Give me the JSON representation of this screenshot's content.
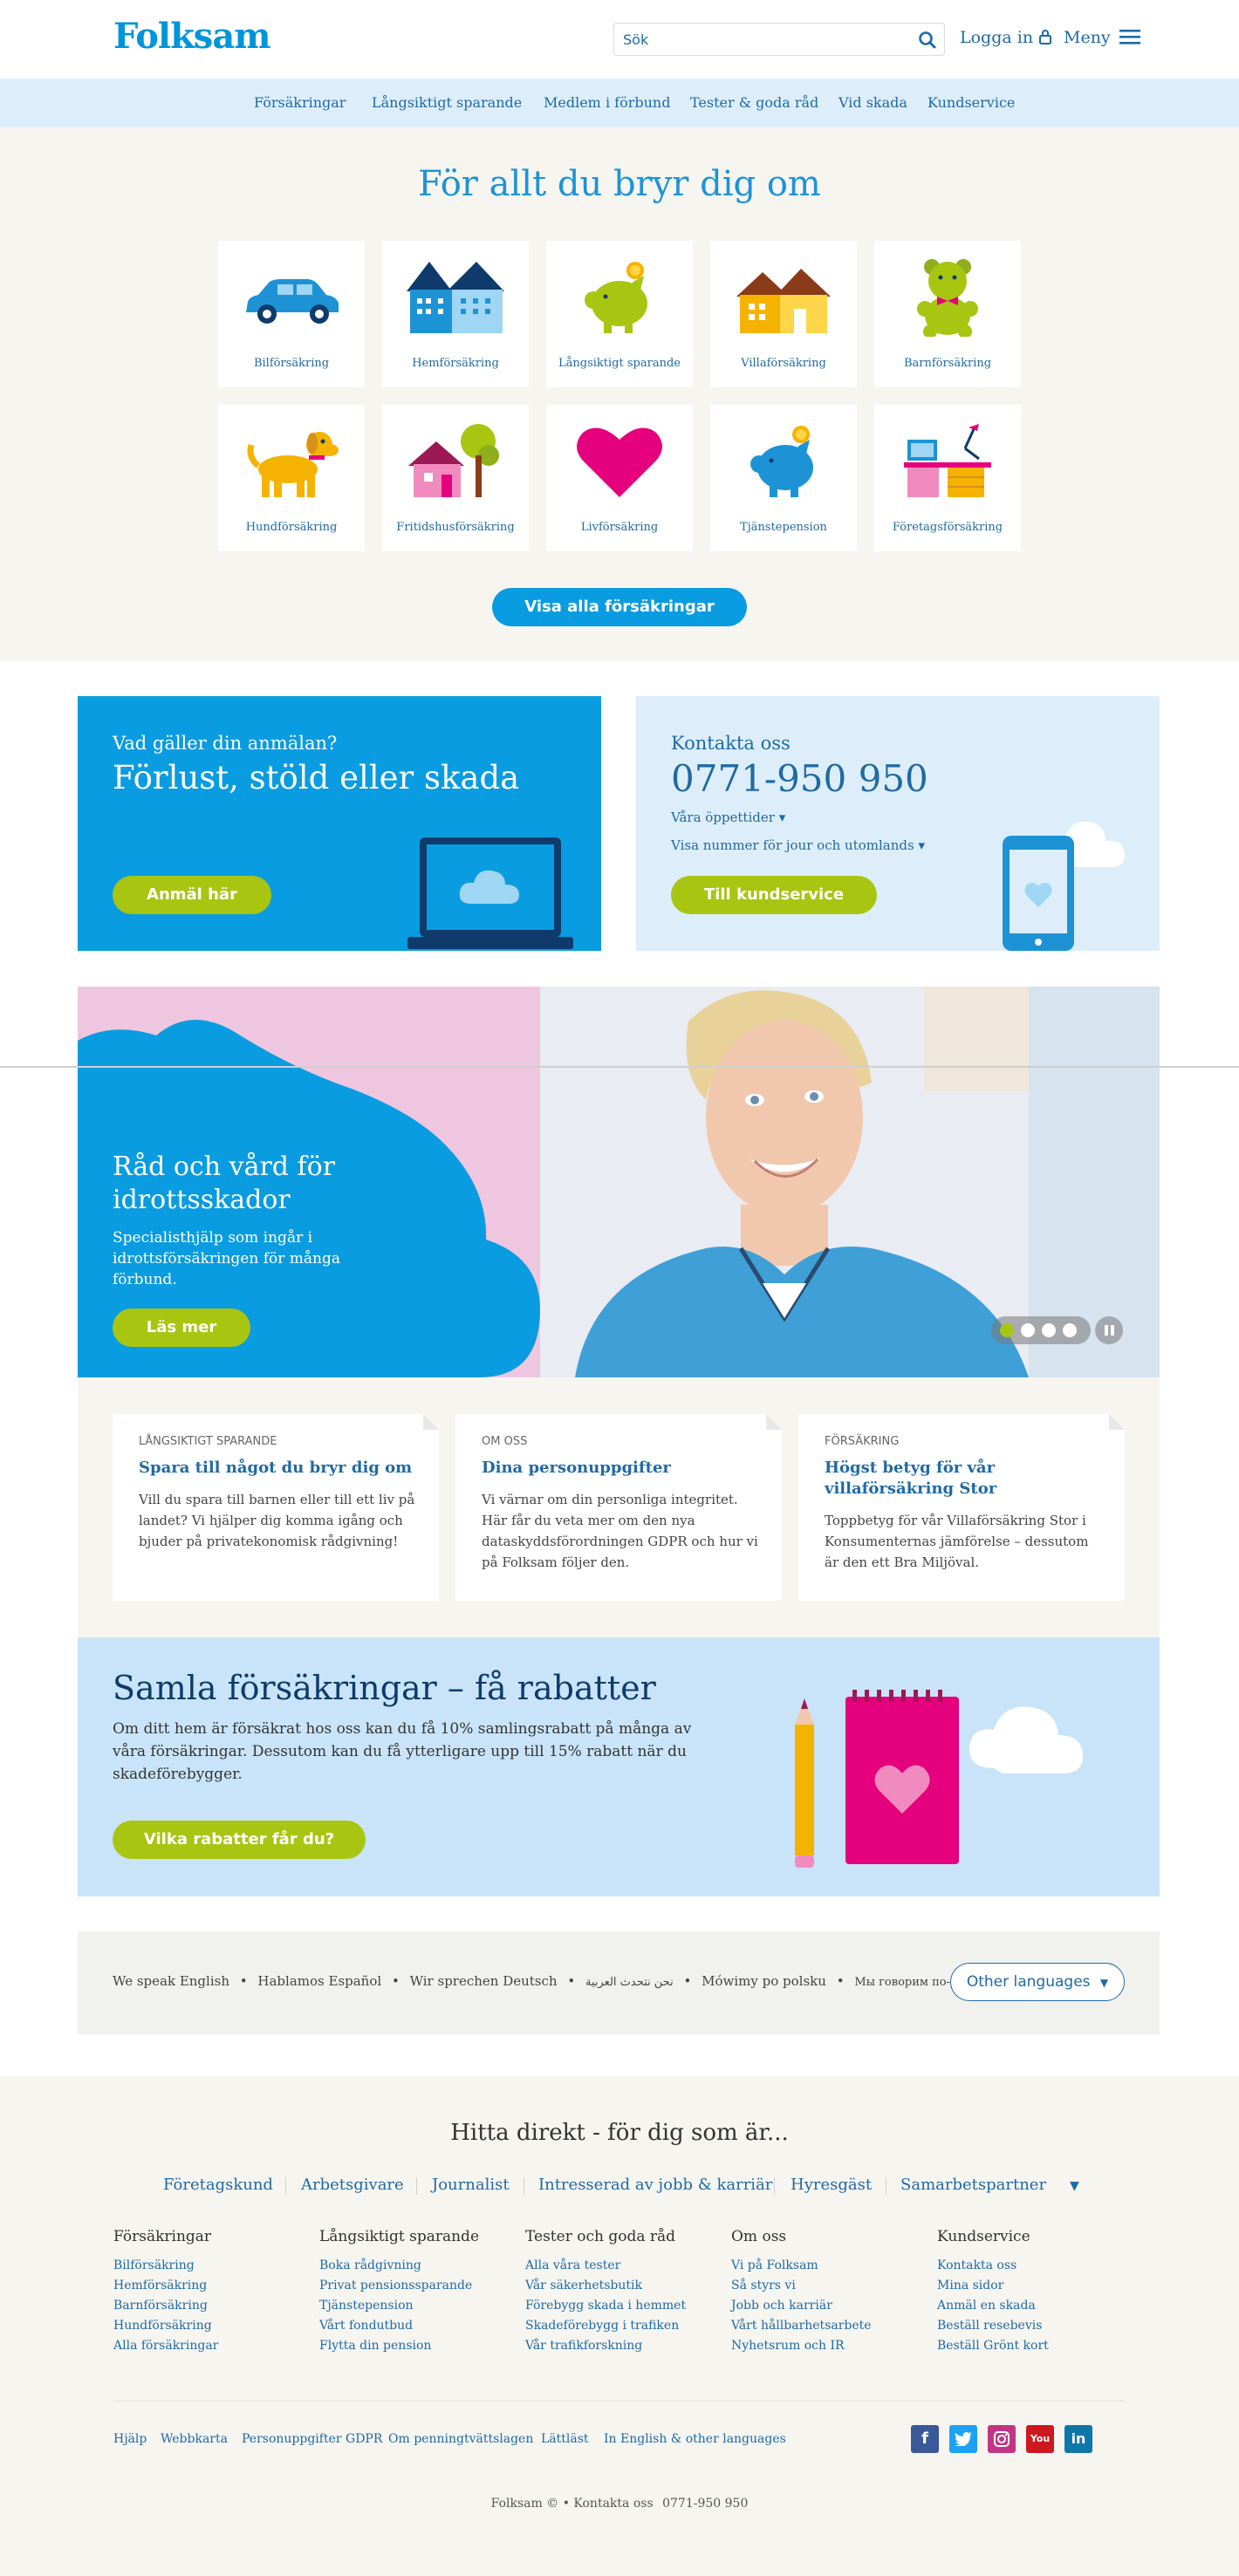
{
  "header": {
    "logo": "Folksam",
    "search_placeholder": "Sök",
    "login": "Logga in",
    "menu": "Meny"
  },
  "nav": [
    "Försäkringar",
    "Långsiktigt sparande",
    "Medlem i förbund",
    "Tester & goda råd",
    "Vid skada",
    "Kundservice"
  ],
  "insurance": {
    "title": "För allt du bryr dig om",
    "cards": [
      {
        "label": "Bilförsäkring",
        "icon": "car-icon"
      },
      {
        "label": "Hemförsäkring",
        "icon": "apartment-icon"
      },
      {
        "label": "Långsiktigt sparande",
        "icon": "piggy-bank-icon"
      },
      {
        "label": "Villaförsäkring",
        "icon": "house-icon"
      },
      {
        "label": "Barnförsäkring",
        "icon": "teddy-bear-icon"
      },
      {
        "label": "Hundförsäkring",
        "icon": "dog-icon"
      },
      {
        "label": "Fritidshusförsäkring",
        "icon": "cottage-icon"
      },
      {
        "label": "Livförsäkring",
        "icon": "heart-icon"
      },
      {
        "label": "Tjänstepension",
        "icon": "pension-piggy-icon"
      },
      {
        "label": "Företagsförsäkring",
        "icon": "office-desk-icon"
      }
    ],
    "show_all": "Visa alla försäkringar"
  },
  "damage": {
    "kicker": "Vad gäller din anmälan?",
    "title": "Förlust, stöld eller skada",
    "button": "Anmäl här"
  },
  "contact": {
    "kicker": "Kontakta oss",
    "phone": "0771-950 950",
    "hours": "Våra öppettider",
    "numbers": "Visa nummer för jour och utomlands",
    "button": "Till kundservice"
  },
  "promo": {
    "title": "Råd och vård för idrottsskador",
    "text": "Specialisthjälp som ingår i idrottsförsäkringen för många förbund.",
    "button": "Läs mer",
    "slides": 4,
    "active_slide": 1
  },
  "articles": [
    {
      "category": "LÅNGSIKTIGT SPARANDE",
      "title": "Spara till något du bryr dig om",
      "text": "Vill du spara till barnen eller till ett liv på landet? Vi hjälper dig komma igång och bjuder på privatekonomisk rådgivning!"
    },
    {
      "category": "OM OSS",
      "title": "Dina personuppgifter",
      "text": "Vi värnar om din personliga integritet. Här får du veta mer om den nya dataskyddsförordningen GDPR och hur vi på Folksam följer den."
    },
    {
      "category": "FÖRSÄKRING",
      "title": "Högst betyg för vår villaförsäkring Stor",
      "text": "Toppbetyg för vår Villaförsäkring Stor i Konsumenternas jämförelse – dessutom är den ett Bra Miljöval."
    }
  ],
  "discounts": {
    "title": "Samla försäkringar – få rabatter",
    "text": "Om ditt hem är försäkrat hos oss kan du få 10% samlingsrabatt på många av våra försäkringar. Dessutom kan du få ytterligare upp till 15% rabatt när du skadeförebygger.",
    "button": "Vilka rabatter får du?"
  },
  "languages": {
    "items": [
      "We speak English",
      "Hablamos Español",
      "Wir sprechen Deutsch",
      "نحن نتحدث العربية",
      "Mówimy po polsku",
      "Мы говорим по-русски"
    ],
    "other": "Other languages"
  },
  "footer": {
    "find_title": "Hitta direkt - för dig som är...",
    "find_links": [
      "Företagskund",
      "Arbetsgivare",
      "Journalist",
      "Intresserad av jobb & karriär",
      "Hyresgäst",
      "Samarbetspartner"
    ],
    "columns": [
      {
        "title": "Försäkringar",
        "links": [
          "Bilförsäkring",
          "Hemförsäkring",
          "Barnförsäkring",
          "Hundförsäkring",
          "Alla försäkringar"
        ]
      },
      {
        "title": "Långsiktigt sparande",
        "links": [
          "Boka rådgivning",
          "Privat pensionssparande",
          "Tjänstepension",
          "Vårt fondutbud",
          "Flytta din pension"
        ]
      },
      {
        "title": "Tester och goda råd",
        "links": [
          "Alla våra tester",
          "Vår säkerhetsbutik",
          "Förebygg skada i hemmet",
          "Skadeförebygg i trafiken",
          "Vår trafikforskning"
        ]
      },
      {
        "title": "Om oss",
        "links": [
          "Vi på Folksam",
          "Så styrs vi",
          "Jobb och karriär",
          "Vårt hållbarhetsarbete",
          "Nyhetsrum och IR"
        ]
      },
      {
        "title": "Kundservice",
        "links": [
          "Kontakta oss",
          "Mina sidor",
          "Anmäl en skada",
          "Beställ resebevis",
          "Beställ Grönt kort"
        ]
      }
    ],
    "bottom_links": [
      "Hjälp",
      "Webbkarta",
      "Personuppgifter GDPR",
      "Om penningtvättslagen",
      "Lättläst",
      "In English & other languages"
    ],
    "copyright": "Folksam ©",
    "contact_label": "Kontakta oss",
    "contact_phone": "0771-950 950"
  },
  "colors": {
    "brand_blue": "#0a9ce0",
    "link_blue": "#1f6aa5",
    "green": "#a8c512",
    "pink": "#e5007d"
  }
}
